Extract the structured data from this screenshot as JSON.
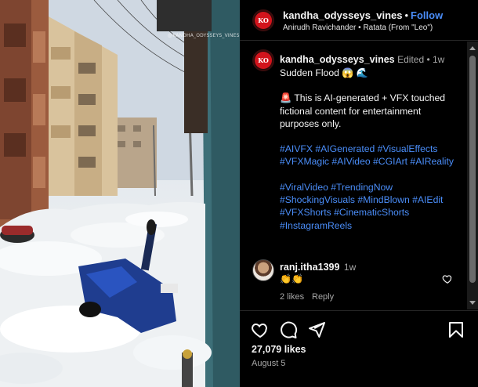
{
  "media": {
    "watermark": "@KANDHA_ODYSSEYS_VINES"
  },
  "header": {
    "avatar_text": "KO",
    "username": "kandha_odysseys_vines",
    "separator": "•",
    "follow_label": "Follow",
    "audio": "Anirudh Ravichander • Ratata (From \"Leo\")"
  },
  "caption": {
    "avatar_text": "KO",
    "username": "kandha_odysseys_vines",
    "meta": "Edited • 1w",
    "title": "Sudden Flood 😱 🌊",
    "disclaimer": "🚨 This is AI-generated + VFX touched fictional content for entertainment purposes only.",
    "tags_1": "#AIVFX #AIGenerated #VisualEffects #VFXMagic #AIVideo #CGIArt #AIReality",
    "tags_2": "#ViralVideo #TrendingNow #ShockingVisuals #MindBlown #AIEdit #VFXShorts #CinematicShorts #InstagramReels"
  },
  "comment": {
    "username": "ranj.itha1399",
    "time": "1w",
    "text": "👏👏",
    "likes": "2 likes",
    "reply_label": "Reply"
  },
  "actions": {
    "like_icon": "heart-icon",
    "comment_icon": "comment-icon",
    "share_icon": "paper-plane-icon",
    "save_icon": "bookmark-icon",
    "likes_count": "27,079 likes",
    "date": "August 5"
  },
  "colors": {
    "accent": "#4a8df8",
    "background": "#000000",
    "brand_red": "#d2141c"
  }
}
